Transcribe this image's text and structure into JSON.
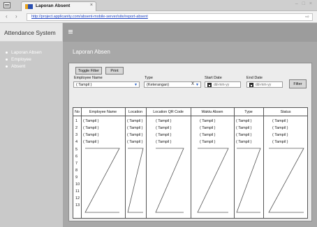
{
  "browser": {
    "tab_title": "Laporan Absent",
    "tab_close": "×",
    "window_controls": "– □ ×",
    "back": "‹",
    "forward": "›",
    "url": "http://project.applicanity.com/absent-mobile-server/site/report-absent",
    "go": "⇨"
  },
  "sidebar": {
    "app_title": "Attendance System",
    "items": [
      {
        "label": "Laporan Absen"
      },
      {
        "label": "Employee"
      },
      {
        "label": "Absent"
      }
    ]
  },
  "page": {
    "title": "Laporan Absen"
  },
  "toolbar": {
    "toggle_filter": "Toggle Filter",
    "print": "Print"
  },
  "filters": {
    "employee_label": "Employee Name",
    "employee_value": "( Tampil )",
    "type_label": "Type",
    "type_value": "(Keterangan)",
    "type_clear": "X",
    "start_label": "Start Date",
    "start_placeholder": "dd-mm-yy",
    "end_label": "End Date",
    "end_placeholder": "dd-mm-yy",
    "filter_button": "Filter"
  },
  "table": {
    "headers": [
      "No",
      "Employee Name",
      "Location",
      "Location QR Code",
      "Waktu Absen",
      "Type",
      "Status"
    ],
    "rows": [
      [
        "1",
        "( Tampil )",
        "( Tampil )",
        "( Tampil )",
        "( Tampil )",
        "( Tampil )",
        "( Tampil )"
      ],
      [
        "2",
        "( Tampil )",
        "( Tampil )",
        "( Tampil )",
        "( Tampil )",
        "( Tampil )",
        "( Tampil )"
      ],
      [
        "3",
        "( Tampil )",
        "( Tampil )",
        "( Tampil )",
        "( Tampil )",
        "( Tampil )",
        "( Tampil )"
      ],
      [
        "4",
        "( Tampil )",
        "( Tampil )",
        "( Tampil )",
        "( Tampil )",
        "( Tampil )",
        "( Tampil )"
      ]
    ],
    "empty_row_numbers": [
      "5",
      "6",
      "7",
      "8",
      "9",
      "10",
      "11",
      "12",
      "13"
    ]
  }
}
